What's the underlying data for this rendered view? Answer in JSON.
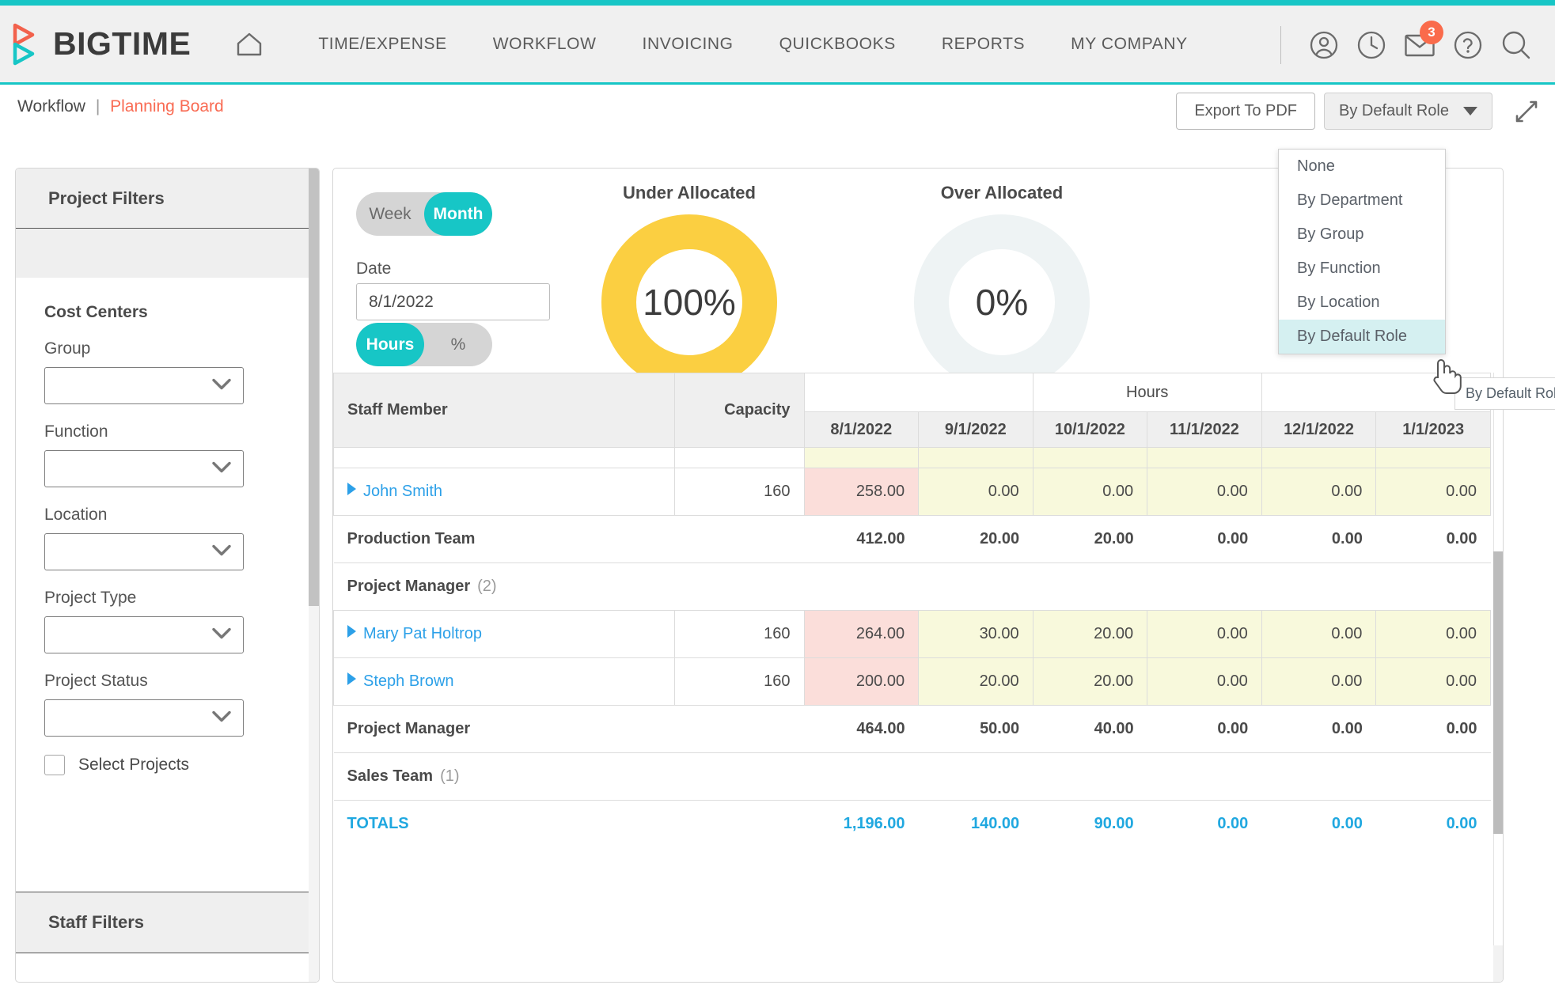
{
  "brand": {
    "name": "BIGTIME",
    "accent": "#17C6C6",
    "logo_red": "#F2614C"
  },
  "header": {
    "home_icon": "home-icon",
    "nav": [
      {
        "label": "TIME/EXPENSE"
      },
      {
        "label": "WORKFLOW"
      },
      {
        "label": "INVOICING"
      },
      {
        "label": "QUICKBOOKS"
      },
      {
        "label": "REPORTS"
      },
      {
        "label": "MY COMPANY"
      }
    ],
    "icons": [
      {
        "name": "user-account-icon"
      },
      {
        "name": "clock-icon"
      },
      {
        "name": "mail-icon",
        "badge": "3"
      },
      {
        "name": "help-icon"
      },
      {
        "name": "search-icon"
      }
    ]
  },
  "subbar": {
    "breadcrumb_root": "Workflow",
    "breadcrumb_sep": "|",
    "breadcrumb_current": "Planning Board",
    "export_label": "Export To PDF",
    "group_by_label": "By Default Role",
    "expand_icon": "expand-arrows-icon"
  },
  "dropdown": {
    "open": true,
    "options": [
      "None",
      "By Department",
      "By Group",
      "By Function",
      "By Location",
      "By Default Role"
    ],
    "selected": "By Default Role",
    "tooltip": "By Default Role"
  },
  "sidebar": {
    "project_filters_title": "Project Filters",
    "cost_centers_title": "Cost Centers",
    "fields": [
      {
        "label": "Group",
        "value": ""
      },
      {
        "label": "Function",
        "value": ""
      },
      {
        "label": "Location",
        "value": ""
      },
      {
        "label": "Project Type",
        "value": ""
      },
      {
        "label": "Project Status",
        "value": ""
      }
    ],
    "select_projects_label": "Select Projects",
    "select_projects_checked": false,
    "staff_filters_title": "Staff Filters"
  },
  "controls": {
    "period_toggle": {
      "options": [
        "Week",
        "Month"
      ],
      "selected": "Month"
    },
    "date_label": "Date",
    "date_value": "8/1/2022",
    "unit_toggle": {
      "options": [
        "Hours",
        "%"
      ],
      "selected": "Hours"
    }
  },
  "chart_data": [
    {
      "type": "pie",
      "title": "Under Allocated",
      "value": 100,
      "display": "100%",
      "color": "#FBCF41",
      "track_color": "#FBCF41",
      "ylim": [
        0,
        100
      ]
    },
    {
      "type": "pie",
      "title": "Over Allocated",
      "value": 0,
      "display": "0%",
      "color": "#EEF3F4",
      "track_color": "#EEF3F4",
      "ylim": [
        0,
        100
      ]
    }
  ],
  "table": {
    "col_staff": "Staff Member",
    "col_capacity": "Capacity",
    "col_hours_group": "Hours",
    "date_columns": [
      "8/1/2022",
      "9/1/2022",
      "10/1/2022",
      "11/1/2022",
      "12/1/2022",
      "1/1/2023"
    ],
    "rows": [
      {
        "kind": "partial",
        "name": "",
        "capacity": "",
        "values": [
          "",
          "",
          "",
          "",
          "",
          ""
        ],
        "flags": [
          "ok",
          "ok",
          "ok",
          "ok",
          "ok",
          "ok"
        ]
      },
      {
        "kind": "staff",
        "name": "John Smith",
        "capacity": "160",
        "values": [
          "258.00",
          "0.00",
          "0.00",
          "0.00",
          "0.00",
          "0.00"
        ],
        "flags": [
          "warn",
          "ok",
          "ok",
          "ok",
          "ok",
          "ok"
        ]
      },
      {
        "kind": "subtotal",
        "name": "Production Team",
        "capacity": "",
        "values": [
          "412.00",
          "20.00",
          "20.00",
          "0.00",
          "0.00",
          "0.00"
        ],
        "flags": [
          "none",
          "none",
          "none",
          "none",
          "none",
          "none"
        ]
      },
      {
        "kind": "group",
        "name": "Project Manager",
        "count": "(2)",
        "capacity": "",
        "values": [
          "",
          "",
          "",
          "",
          "",
          ""
        ],
        "flags": [
          "none",
          "none",
          "none",
          "none",
          "none",
          "none"
        ]
      },
      {
        "kind": "staff",
        "name": "Mary Pat Holtrop",
        "capacity": "160",
        "values": [
          "264.00",
          "30.00",
          "20.00",
          "0.00",
          "0.00",
          "0.00"
        ],
        "flags": [
          "warn",
          "ok",
          "ok",
          "ok",
          "ok",
          "ok"
        ]
      },
      {
        "kind": "staff",
        "name": "Steph Brown",
        "capacity": "160",
        "values": [
          "200.00",
          "20.00",
          "20.00",
          "0.00",
          "0.00",
          "0.00"
        ],
        "flags": [
          "warn",
          "ok",
          "ok",
          "ok",
          "ok",
          "ok"
        ]
      },
      {
        "kind": "subtotal",
        "name": "Project Manager",
        "capacity": "",
        "values": [
          "464.00",
          "50.00",
          "40.00",
          "0.00",
          "0.00",
          "0.00"
        ],
        "flags": [
          "none",
          "none",
          "none",
          "none",
          "none",
          "none"
        ]
      },
      {
        "kind": "group",
        "name": "Sales Team",
        "count": "(1)",
        "capacity": "",
        "values": [
          "",
          "",
          "",
          "",
          "",
          ""
        ],
        "flags": [
          "none",
          "none",
          "none",
          "none",
          "none",
          "none"
        ]
      },
      {
        "kind": "totals",
        "name": "TOTALS",
        "capacity": "",
        "values": [
          "1,196.00",
          "140.00",
          "90.00",
          "0.00",
          "0.00",
          "0.00"
        ],
        "flags": [
          "none",
          "none",
          "none",
          "none",
          "none",
          "none"
        ]
      }
    ]
  }
}
